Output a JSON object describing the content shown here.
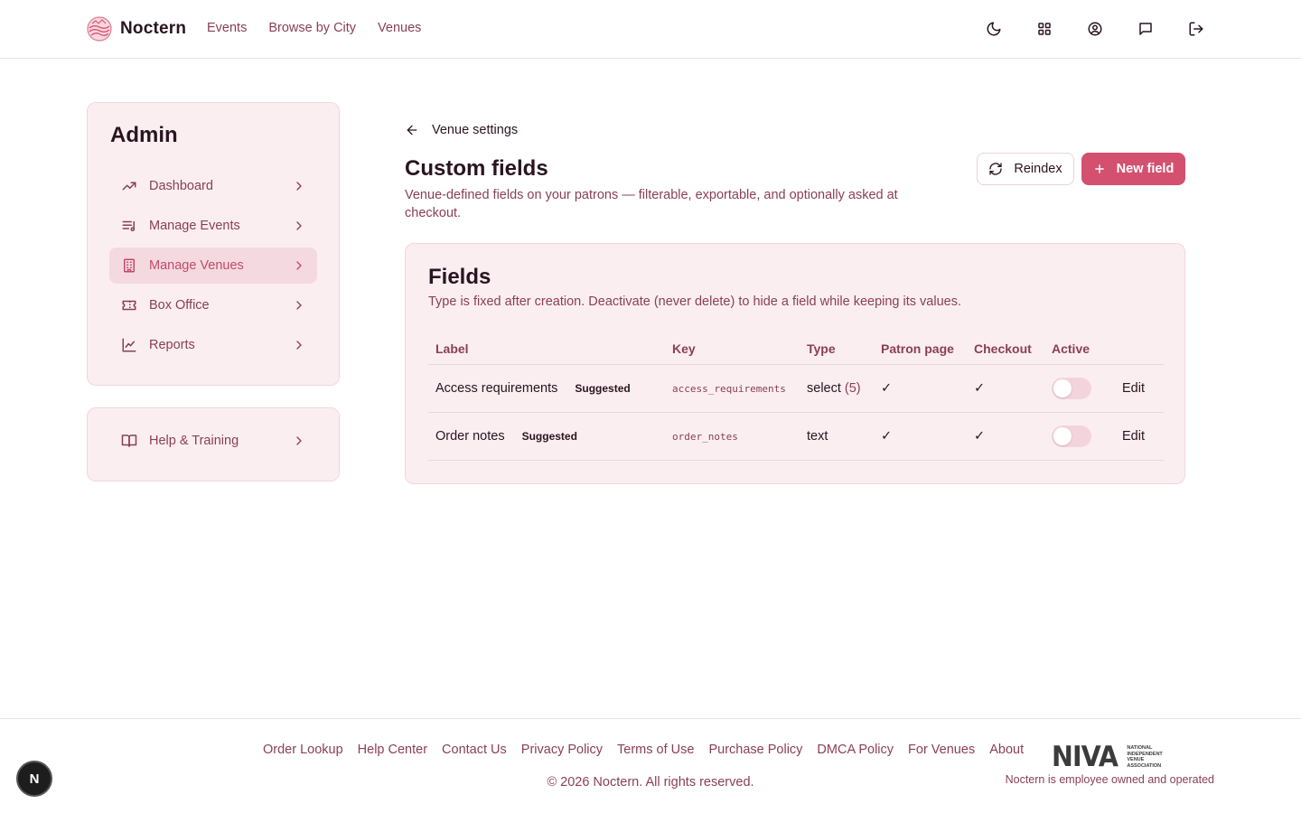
{
  "header": {
    "brand": "Noctern",
    "nav": [
      "Events",
      "Browse by City",
      "Venues"
    ],
    "icons": [
      "moon-icon",
      "grid-icon",
      "account-icon",
      "message-icon",
      "logout-icon"
    ]
  },
  "sidebar": {
    "title": "Admin",
    "items": [
      {
        "label": "Dashboard",
        "icon": "trending-icon"
      },
      {
        "label": "Manage Events",
        "icon": "list-music-icon"
      },
      {
        "label": "Manage Venues",
        "icon": "building-icon",
        "active": true
      },
      {
        "label": "Box Office",
        "icon": "ticket-icon"
      },
      {
        "label": "Reports",
        "icon": "chart-icon"
      }
    ],
    "help": {
      "label": "Help & Training",
      "icon": "book-icon"
    }
  },
  "main": {
    "back_label": "Venue settings",
    "title": "Custom fields",
    "description": "Venue-defined fields on your patrons — filterable, exportable, and optionally asked at checkout.",
    "reindex_label": "Reindex",
    "new_field_label": "New field"
  },
  "fields": {
    "title": "Fields",
    "description": "Type is fixed after creation. Deactivate (never delete) to hide a field while keeping its values.",
    "columns": [
      "Label",
      "Key",
      "Type",
      "Patron page",
      "Checkout",
      "Active"
    ],
    "rows": [
      {
        "label": "Access requirements",
        "badge": "Suggested",
        "key": "access_requirements",
        "type": "select",
        "type_count": "(5)",
        "patron": "✓",
        "checkout": "✓",
        "active": false,
        "edit": "Edit"
      },
      {
        "label": "Order notes",
        "badge": "Suggested",
        "key": "order_notes",
        "type": "text",
        "type_count": "",
        "patron": "✓",
        "checkout": "✓",
        "active": false,
        "edit": "Edit"
      }
    ]
  },
  "footer": {
    "links": [
      "Order Lookup",
      "Help Center",
      "Contact Us",
      "Privacy Policy",
      "Terms of Use",
      "Purchase Policy",
      "DMCA Policy",
      "For Venues",
      "About"
    ],
    "copyright": "© 2026 Noctern. All rights reserved.",
    "niva_word": "NIVA",
    "niva_sub": [
      "NATIONAL",
      "INDEPENDENT",
      "VENUE",
      "ASSOCIATION"
    ],
    "employee_note": "Noctern is employee owned and operated"
  },
  "dev_badge": "N",
  "colors": {
    "accent": "#d4506f",
    "muted_text": "#8a3f55",
    "card_bg": "#fbeef1",
    "active_bg": "#f5d9e0"
  }
}
